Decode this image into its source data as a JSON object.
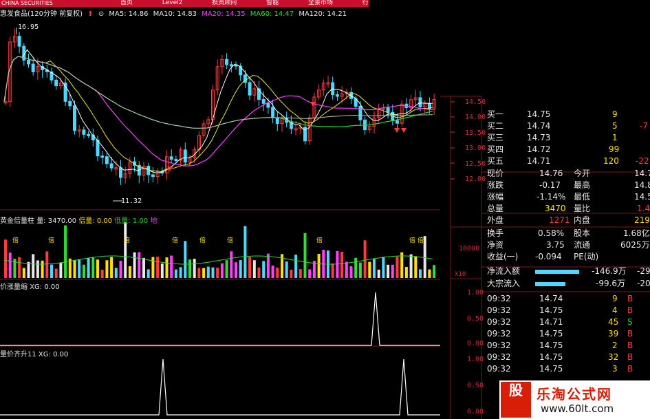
{
  "header": {
    "logo": "CHINA SECURITIES",
    "menu": [
      "首页",
      "Level2",
      "投资顾问",
      "智能",
      "全景市场",
      "行情"
    ]
  },
  "ma_bar": {
    "title": "惠发食品(120分钟 前复权)",
    "ma5": "MA5: 14.86",
    "ma10": "MA10: 14.83",
    "ma20": "MA20: 14.35",
    "ma60": "MA60: 14.47",
    "ma120": "MA120: 14.21"
  },
  "price_axis": [
    "14.50",
    "14.00",
    "13.50",
    "13.00",
    "12.50",
    "12.00"
  ],
  "price_high": "16.95",
  "price_low": "11.32",
  "vol_bar": {
    "name": "黄金倍量柱",
    "vol": "量: 3470.00",
    "bei": "倍量: 0.00",
    "di": "低量: 1.00",
    "di2": "地"
  },
  "vol_axis": [
    "10000"
  ],
  "vol_mult": "X10",
  "ind1": {
    "name": "价涨量缩",
    "xg": "XG: 0.00",
    "axis": [
      "1.00",
      "0.50",
      "0.00"
    ]
  },
  "ind2": {
    "name": "量价齐升11",
    "xg": "XG: 0.00",
    "axis": [
      "1.00",
      "0.50",
      "0.00"
    ]
  },
  "marker": "倍",
  "colors": {
    "up": "#ff3b3b",
    "down": "#4fd8ff",
    "ma5": "#ffffff",
    "ma10": "#e8e83a",
    "ma20": "#ff40ff",
    "ma60": "#33dd33",
    "ma120": "#ffffff",
    "bg": "#000000",
    "panel_line": "#7a1818"
  },
  "quote": {
    "bids": [
      {
        "l": "买一",
        "p": "14.75",
        "v": "9"
      },
      {
        "l": "买二",
        "p": "14.74",
        "v": "5",
        "x": "-7"
      },
      {
        "l": "买三",
        "p": "14.73",
        "v": "1"
      },
      {
        "l": "买四",
        "p": "14.72",
        "v": "99"
      },
      {
        "l": "买五",
        "p": "14.71",
        "v": "120",
        "x": "-22"
      }
    ],
    "stats": [
      {
        "l1": "现价",
        "v1": "14.76",
        "l2": "今开",
        "v2": "14.7"
      },
      {
        "l1": "涨跌",
        "v1": "-0.17",
        "l2": "最高",
        "v2": "14.8"
      },
      {
        "l1": "涨幅",
        "v1": "-1.14%",
        "l2": "最低",
        "v2": "14.5"
      },
      {
        "l1": "总量",
        "v1": "3470",
        "l2": "量比",
        "v2": "1.4"
      },
      {
        "l1": "外盘",
        "v1": "1271",
        "l2": "内盘",
        "v2": "219"
      },
      {
        "l1": "换手",
        "v1": "0.58%",
        "l2": "股本",
        "v2": "1.68亿"
      },
      {
        "l1": "净资",
        "v1": "3.75",
        "l2": "流通",
        "v2": "6025万"
      },
      {
        "l1": "收益(一)",
        "v1": "-0.094",
        "l2": "PE(动)",
        "v2": ""
      }
    ],
    "flow": [
      {
        "l": "净流入额",
        "v": "-146.9万",
        "x": "-29"
      },
      {
        "l": "大宗流入",
        "v": "-99.6万",
        "x": "-20"
      }
    ],
    "ticks": [
      {
        "t": "09:32",
        "p": "14.74",
        "v": "9",
        "s": "B"
      },
      {
        "t": "09:32",
        "p": "14.75",
        "v": "4",
        "s": "B"
      },
      {
        "t": "09:32",
        "p": "14.71",
        "v": "45",
        "s": "S"
      },
      {
        "t": "09:32",
        "p": "14.75",
        "v": "39",
        "s": "B"
      },
      {
        "t": "09:32",
        "p": "14.75",
        "v": "2",
        "s": "B"
      },
      {
        "t": "09:32",
        "p": "14.75",
        "v": "32",
        "s": "B"
      },
      {
        "t": "09:32",
        "p": "14.75",
        "v": "3",
        "s": "B"
      }
    ]
  },
  "watermark": {
    "badge": "股",
    "site": "乐淘公式网",
    "url": "www.60lt.com"
  }
}
